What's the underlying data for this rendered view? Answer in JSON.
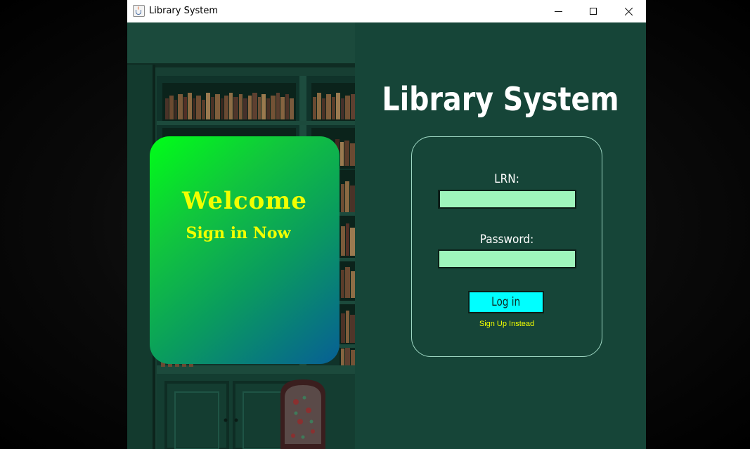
{
  "window": {
    "title": "Library System",
    "controls": {
      "minimize": "minimize",
      "maximize": "maximize",
      "close": "close"
    }
  },
  "welcome": {
    "title": "Welcome",
    "subtitle": "Sign in Now"
  },
  "app_title": "Library System",
  "login": {
    "lrn_label": "LRN:",
    "lrn_value": "",
    "password_label": "Password:",
    "password_value": "",
    "login_button": "Log in",
    "signup_link": "Sign Up Instead"
  },
  "colors": {
    "right_panel": "#164538",
    "input_fill": "#9ff5bc",
    "button_fill": "#00ffff",
    "accent_yellow": "#f2ff00",
    "card_gradient_start": "#00ff17",
    "card_gradient_end": "#075f95"
  },
  "icons": [
    "java-app-icon",
    "minimize-icon",
    "maximize-icon",
    "close-icon"
  ]
}
